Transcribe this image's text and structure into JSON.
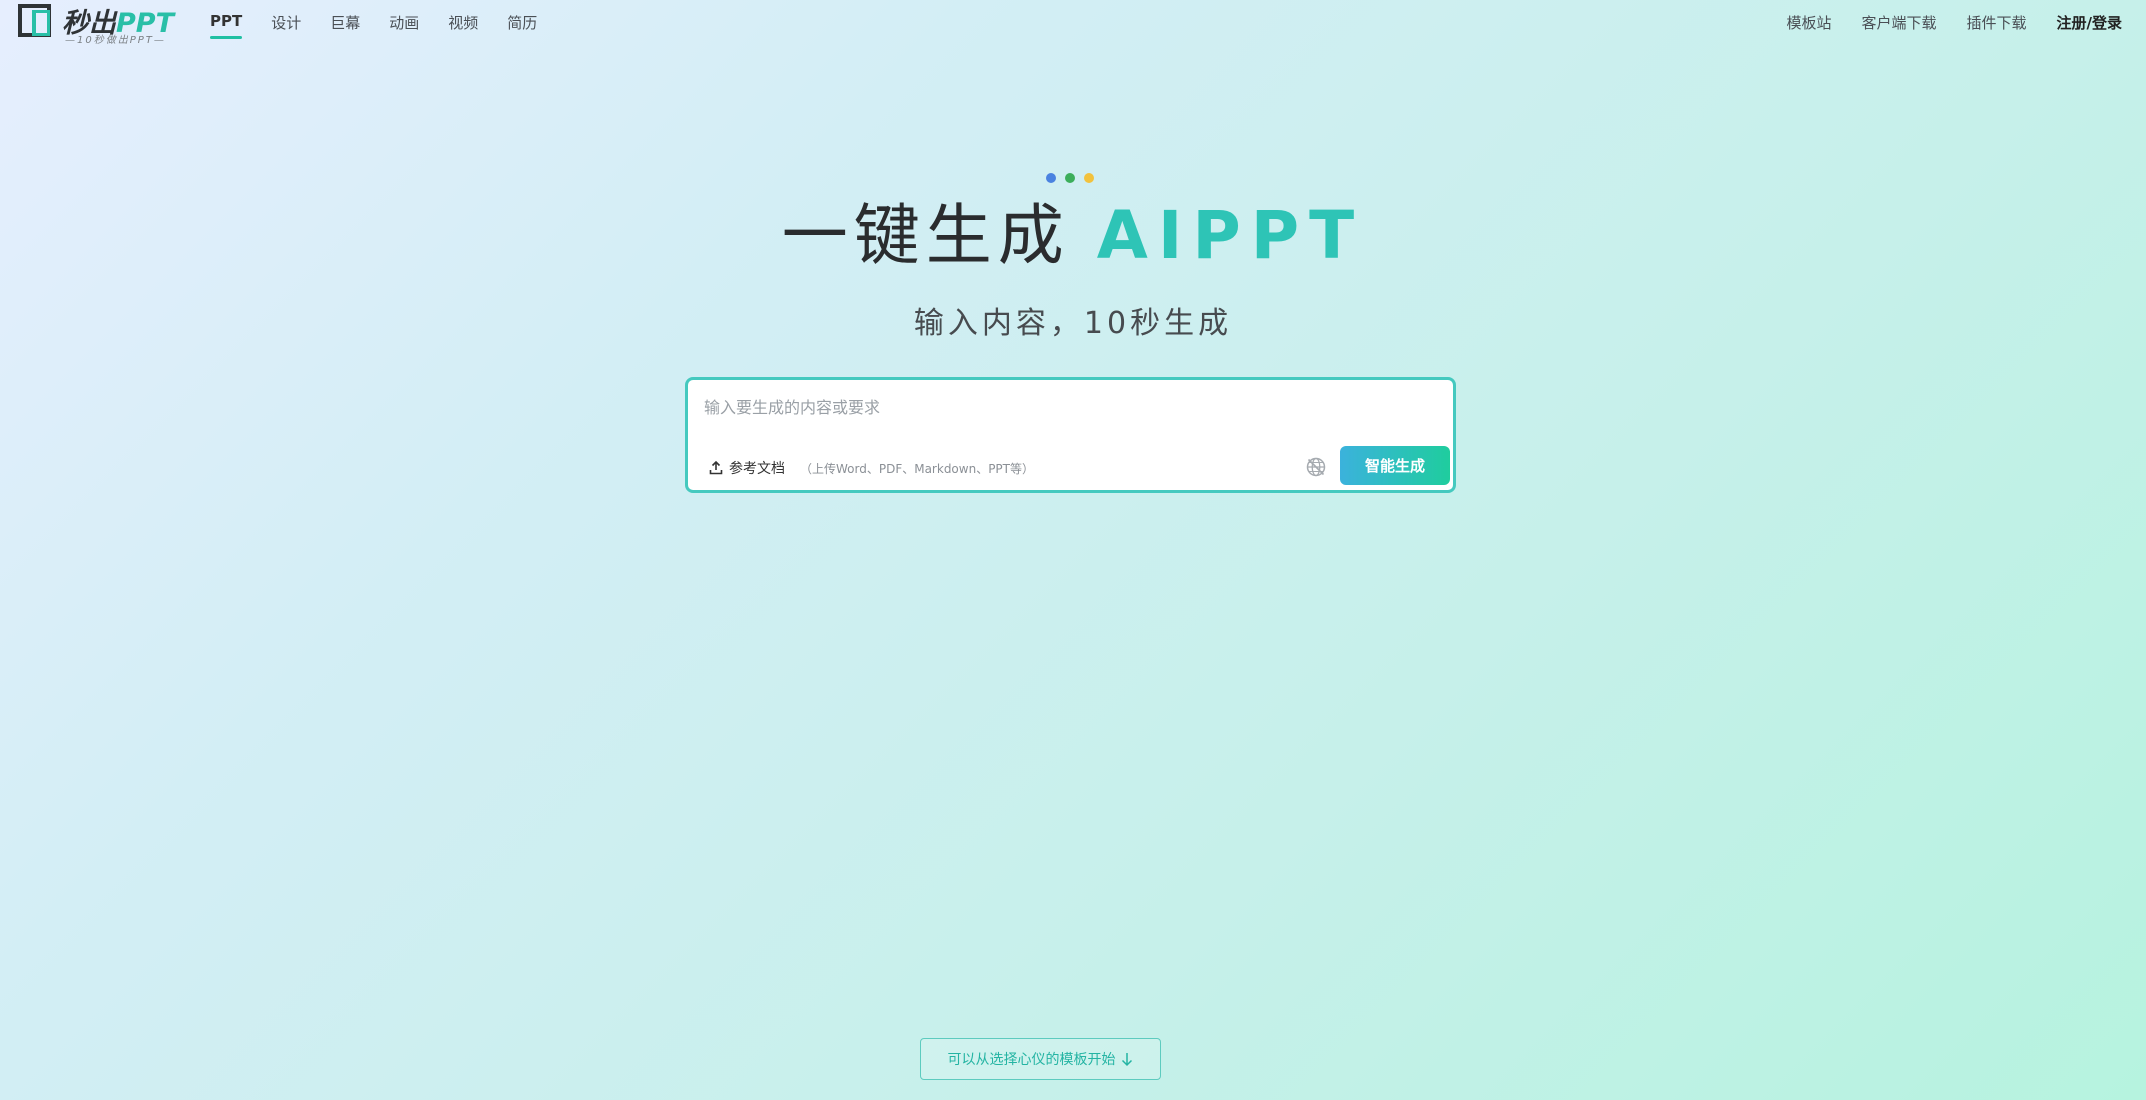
{
  "logo": {
    "main_prefix": "秒出",
    "main_ppt": "PPT",
    "sub": "—10秒做出PPT—"
  },
  "nav": {
    "items": [
      {
        "label": "PPT",
        "active": true
      },
      {
        "label": "设计"
      },
      {
        "label": "巨幕"
      },
      {
        "label": "动画"
      },
      {
        "label": "视频"
      },
      {
        "label": "简历"
      }
    ]
  },
  "right_nav": {
    "template_site": "模板站",
    "client_download": "客户端下载",
    "plugin_download": "插件下载",
    "login": "注册/登录"
  },
  "hero": {
    "dot_colors": [
      "#4a82e0",
      "#3cae5b",
      "#f2c23d"
    ],
    "title_prefix": "一键生成",
    "title_accent": "AIPPT",
    "subtitle": "输入内容，10秒生成"
  },
  "input": {
    "placeholder": "输入要生成的内容或要求",
    "upload_label": "参考文档",
    "upload_hint": "（上传Word、PDF、Markdown、PPT等）",
    "generate_label": "智能生成"
  },
  "footer": {
    "template_hint": "可以从选择心仪的模板开始"
  },
  "colors": {
    "accent": "#2ec4b6",
    "border": "#45c9bf"
  }
}
